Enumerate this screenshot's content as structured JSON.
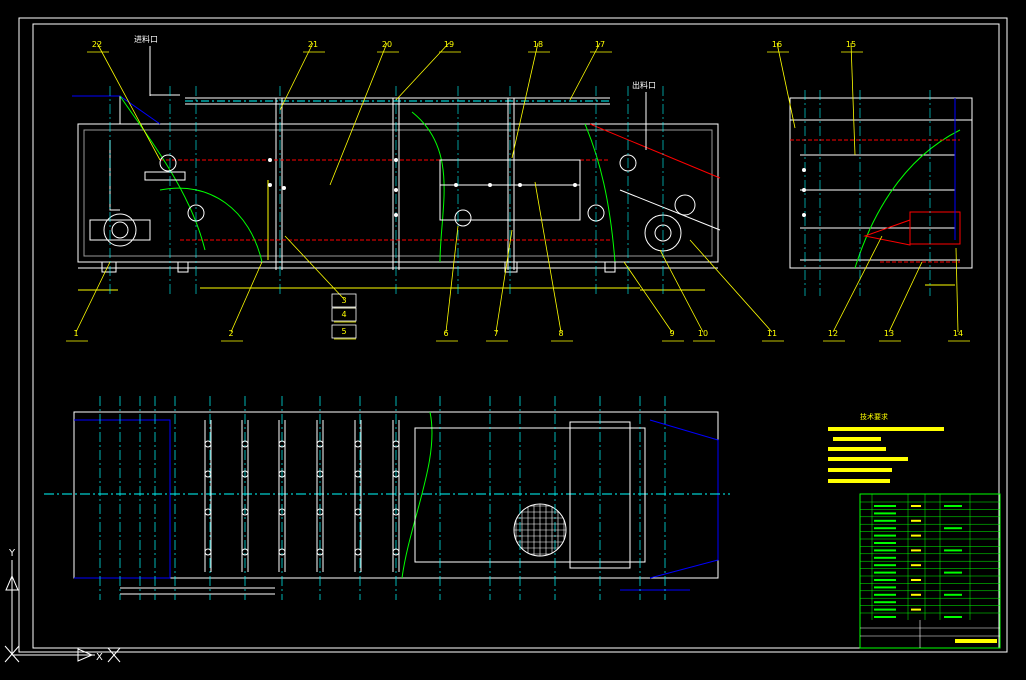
{
  "drawing": {
    "callouts": [
      "1",
      "2",
      "3",
      "4",
      "5",
      "6",
      "7",
      "8",
      "9",
      "10",
      "11",
      "12",
      "13",
      "14",
      "15",
      "16",
      "17",
      "18",
      "19",
      "20",
      "21",
      "22"
    ],
    "inlet_label": "进料口",
    "outlet_label": "出料口",
    "tech_req_title": "技术要求",
    "colors": {
      "background": "#000000",
      "frame": "#ffffff",
      "callout": "#ffff00",
      "centerline": "#00ffff",
      "hidden": "#ff0000",
      "outline": "#0000ff",
      "break": "#00ff00",
      "table": "#00ff00",
      "annotation": "#ffff00"
    }
  },
  "ucs": {
    "x_label": "X",
    "y_label": "Y"
  }
}
